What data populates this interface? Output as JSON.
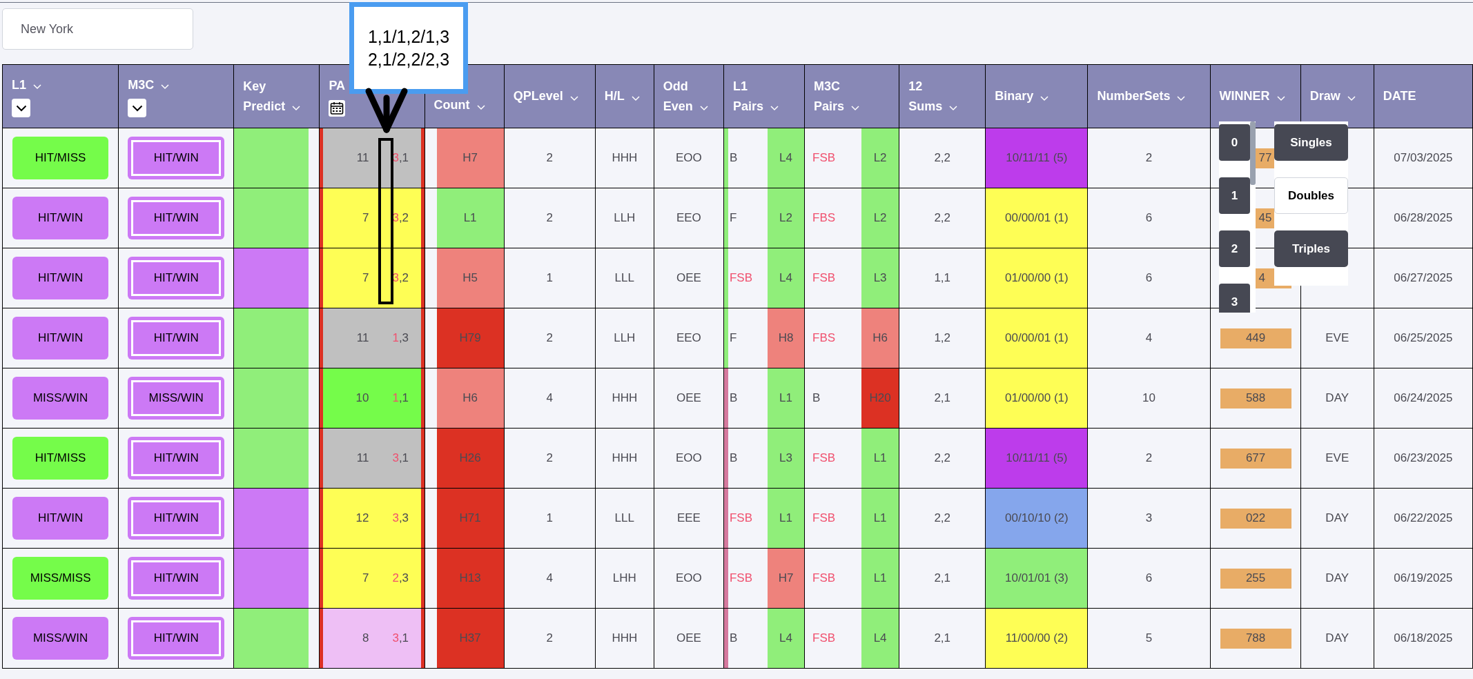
{
  "search": {
    "value": "New York"
  },
  "columns": [
    {
      "label": [
        "L1"
      ],
      "chevron": true,
      "kind": "dropdown"
    },
    {
      "label": [
        "M3C"
      ],
      "chevron": true,
      "kind": "dropdown"
    },
    {
      "label": [
        "Key",
        "Predict"
      ],
      "chevron": true
    },
    {
      "label": [
        "PA"
      ],
      "chevron": false,
      "kind": "calendar"
    },
    {
      "label": [
        "Count"
      ],
      "chevron": true
    },
    {
      "label": [
        "QPLevel"
      ],
      "chevron": true
    },
    {
      "label": [
        "H/L"
      ],
      "chevron": true
    },
    {
      "label": [
        "Odd",
        "Even"
      ],
      "chevron": true
    },
    {
      "label": [
        "L1",
        "Pairs"
      ],
      "chevron": true
    },
    {
      "label": [
        "M3C",
        "Pairs"
      ],
      "chevron": true
    },
    {
      "label": [
        "12",
        "Sums"
      ],
      "chevron": true
    },
    {
      "label": [
        "Binary"
      ],
      "chevron": true
    },
    {
      "label": [
        "NumberSets"
      ],
      "chevron": true
    },
    {
      "label": [
        "WINNER"
      ],
      "chevron": true
    },
    {
      "label": [
        "Draw"
      ],
      "chevron": true
    },
    {
      "label": [
        "DATE"
      ],
      "chevron": false
    }
  ],
  "rows": [
    {
      "l1": {
        "text": "HIT/MISS",
        "color": "#75fc4a"
      },
      "m3c": "HIT/WIN",
      "key": {
        "color": "#90ee7a"
      },
      "pair": {
        "color": "#c0c0c0",
        "sum": "11",
        "first": "3",
        "rest": ",1"
      },
      "count": {
        "text": "H7",
        "color": "#ee827c"
      },
      "qp": "2",
      "hl": "HHH",
      "oe": "EOO",
      "marker": {
        "color": "#90ee7a"
      },
      "l1_pairs": {
        "tag": {
          "text": "B",
          "color": "#4a4a52"
        },
        "code": {
          "text": "L4",
          "color": "#90ee7a"
        }
      },
      "m3c_pairs": {
        "tag": {
          "text": "FSB",
          "color": "#f0506e"
        },
        "code": {
          "text": "L2",
          "color": "#90ee7a"
        }
      },
      "sums": "2,2",
      "binary": {
        "text": "10/11/11 (5)",
        "color": "#bd3ceb"
      },
      "number_sets": "2",
      "winner": {
        "text": "77",
        "covered": true
      },
      "date": "07/03/2025"
    },
    {
      "l1": {
        "text": "HIT/WIN",
        "color": "#cc79f5"
      },
      "m3c": "HIT/WIN",
      "key": {
        "color": "#90ee7a"
      },
      "pair": {
        "color": "#fefe55",
        "sum": "7",
        "first": "3",
        "rest": ",2"
      },
      "count": {
        "text": "L1",
        "color": "#90ee7a"
      },
      "qp": "2",
      "hl": "LLH",
      "oe": "EEO",
      "marker": {
        "color": "#90ee7a"
      },
      "l1_pairs": {
        "tag": {
          "text": "F",
          "color": "#4a4a52"
        },
        "code": {
          "text": "L2",
          "color": "#90ee7a"
        }
      },
      "m3c_pairs": {
        "tag": {
          "text": "FBS",
          "color": "#f0506e"
        },
        "code": {
          "text": "L2",
          "color": "#90ee7a"
        }
      },
      "sums": "2,2",
      "binary": {
        "text": "00/00/01 (1)",
        "color": "#fefe55"
      },
      "number_sets": "6",
      "winner": {
        "text": "45",
        "covered": true
      },
      "date": "06/28/2025"
    },
    {
      "l1": {
        "text": "HIT/WIN",
        "color": "#cc79f5"
      },
      "m3c": "HIT/WIN",
      "key": {
        "color": "#cc79f5"
      },
      "pair": {
        "color": "#fefe55",
        "sum": "7",
        "first": "3",
        "rest": ",2"
      },
      "count": {
        "text": "H5",
        "color": "#ee827c"
      },
      "qp": "1",
      "hl": "LLL",
      "oe": "OEE",
      "marker": {
        "color": "#90ee7a"
      },
      "l1_pairs": {
        "tag": {
          "text": "FSB",
          "color": "#f0506e"
        },
        "code": {
          "text": "L4",
          "color": "#90ee7a"
        }
      },
      "m3c_pairs": {
        "tag": {
          "text": "FSB",
          "color": "#f0506e"
        },
        "code": {
          "text": "L3",
          "color": "#90ee7a"
        }
      },
      "sums": "1,1",
      "binary": {
        "text": "01/00/00 (1)",
        "color": "#fefe55"
      },
      "number_sets": "6",
      "winner": {
        "text": "4",
        "covered": true
      },
      "date": "06/27/2025"
    },
    {
      "l1": {
        "text": "HIT/WIN",
        "color": "#cc79f5"
      },
      "m3c": "HIT/WIN",
      "key": {
        "color": "#90ee7a"
      },
      "pair": {
        "color": "#c0c0c0",
        "sum": "11",
        "first": "1",
        "rest": ",3"
      },
      "count": {
        "text": "H79",
        "color": "#dc3123"
      },
      "qp": "2",
      "hl": "LLH",
      "oe": "EEO",
      "marker": {
        "color": "#90ee7a"
      },
      "l1_pairs": {
        "tag": {
          "text": "F",
          "color": "#4a4a52"
        },
        "code": {
          "text": "H8",
          "color": "#ee827c"
        }
      },
      "m3c_pairs": {
        "tag": {
          "text": "FBS",
          "color": "#f0506e"
        },
        "code": {
          "text": "H6",
          "color": "#ee827c"
        }
      },
      "sums": "1,2",
      "binary": {
        "text": "00/00/01 (1)",
        "color": "#fefe55"
      },
      "number_sets": "4",
      "winner": {
        "text": "449",
        "covered": false
      },
      "draw": "EVE",
      "date": "06/25/2025"
    },
    {
      "l1": {
        "text": "MISS/WIN",
        "color": "#cc79f5"
      },
      "m3c": "MISS/WIN",
      "key": {
        "color": "#90ee7a"
      },
      "pair": {
        "color": "#75fc4a",
        "sum": "10",
        "first": "1",
        "rest": ",1"
      },
      "count": {
        "text": "H6",
        "color": "#ee827c"
      },
      "qp": "4",
      "hl": "HHH",
      "oe": "OEE",
      "marker": {
        "color": "#d57a9e"
      },
      "l1_pairs": {
        "tag": {
          "text": "B",
          "color": "#4a4a52"
        },
        "code": {
          "text": "L1",
          "color": "#90ee7a"
        }
      },
      "m3c_pairs": {
        "tag": {
          "text": "B",
          "color": "#4a4a52"
        },
        "code": {
          "text": "H20",
          "color": "#dc3123"
        }
      },
      "sums": "2,1",
      "binary": {
        "text": "01/00/00 (1)",
        "color": "#fefe55"
      },
      "number_sets": "10",
      "winner": {
        "text": "588",
        "covered": false
      },
      "draw": "DAY",
      "date": "06/24/2025"
    },
    {
      "l1": {
        "text": "HIT/MISS",
        "color": "#75fc4a"
      },
      "m3c": "HIT/WIN",
      "key": {
        "color": "#90ee7a"
      },
      "pair": {
        "color": "#c0c0c0",
        "sum": "11",
        "first": "3",
        "rest": ",1"
      },
      "count": {
        "text": "H26",
        "color": "#dc3123"
      },
      "qp": "2",
      "hl": "HHH",
      "oe": "EOO",
      "marker": {
        "color": "#d57a9e"
      },
      "l1_pairs": {
        "tag": {
          "text": "B",
          "color": "#4a4a52"
        },
        "code": {
          "text": "L3",
          "color": "#90ee7a"
        }
      },
      "m3c_pairs": {
        "tag": {
          "text": "FSB",
          "color": "#f0506e"
        },
        "code": {
          "text": "L1",
          "color": "#90ee7a"
        }
      },
      "sums": "2,2",
      "binary": {
        "text": "10/11/11 (5)",
        "color": "#bd3ceb"
      },
      "number_sets": "2",
      "winner": {
        "text": "677",
        "covered": false
      },
      "draw": "EVE",
      "date": "06/23/2025"
    },
    {
      "l1": {
        "text": "HIT/WIN",
        "color": "#cc79f5"
      },
      "m3c": "HIT/WIN",
      "key": {
        "color": "#cc79f5"
      },
      "pair": {
        "color": "#fefe55",
        "sum": "12",
        "first": "3",
        "rest": ",3"
      },
      "count": {
        "text": "H71",
        "color": "#dc3123"
      },
      "qp": "1",
      "hl": "LLL",
      "oe": "EEE",
      "marker": {
        "color": "#d57a9e"
      },
      "l1_pairs": {
        "tag": {
          "text": "FSB",
          "color": "#f0506e"
        },
        "code": {
          "text": "L1",
          "color": "#90ee7a"
        }
      },
      "m3c_pairs": {
        "tag": {
          "text": "FSB",
          "color": "#f0506e"
        },
        "code": {
          "text": "L1",
          "color": "#90ee7a"
        }
      },
      "sums": "2,2",
      "binary": {
        "text": "00/10/10 (2)",
        "color": "#85a6ec"
      },
      "number_sets": "3",
      "winner": {
        "text": "022",
        "covered": false
      },
      "draw": "DAY",
      "date": "06/22/2025"
    },
    {
      "l1": {
        "text": "MISS/MISS",
        "color": "#75fc4a"
      },
      "m3c": "HIT/WIN",
      "key": {
        "color": "#cc79f5"
      },
      "pair": {
        "color": "#fefe55",
        "sum": "7",
        "first": "2",
        "rest": ",3"
      },
      "count": {
        "text": "H13",
        "color": "#dc3123"
      },
      "qp": "4",
      "hl": "LHH",
      "oe": "EOO",
      "marker": {
        "color": "#d57a9e"
      },
      "l1_pairs": {
        "tag": {
          "text": "FSB",
          "color": "#f0506e"
        },
        "code": {
          "text": "H7",
          "color": "#ee827c"
        }
      },
      "m3c_pairs": {
        "tag": {
          "text": "FSB",
          "color": "#f0506e"
        },
        "code": {
          "text": "L1",
          "color": "#90ee7a"
        }
      },
      "sums": "2,1",
      "binary": {
        "text": "10/01/01 (3)",
        "color": "#90ee7a"
      },
      "number_sets": "6",
      "winner": {
        "text": "255",
        "covered": false
      },
      "draw": "DAY",
      "date": "06/19/2025"
    },
    {
      "l1": {
        "text": "MISS/WIN",
        "color": "#cc79f5"
      },
      "m3c": "HIT/WIN",
      "key": {
        "color": "#90ee7a"
      },
      "pair": {
        "color": "#eebff5",
        "sum": "8",
        "first": "3",
        "rest": ",1"
      },
      "count": {
        "text": "H37",
        "color": "#dc3123"
      },
      "qp": "2",
      "hl": "HHH",
      "oe": "OEE",
      "marker": {
        "color": "#d57a9e"
      },
      "l1_pairs": {
        "tag": {
          "text": "B",
          "color": "#4a4a52"
        },
        "code": {
          "text": "L4",
          "color": "#90ee7a"
        }
      },
      "m3c_pairs": {
        "tag": {
          "text": "FSB",
          "color": "#f0506e"
        },
        "code": {
          "text": "L4",
          "color": "#90ee7a"
        }
      },
      "sums": "2,1",
      "binary": {
        "text": "11/00/00 (2)",
        "color": "#fefe55"
      },
      "number_sets": "5",
      "winner": {
        "text": "788",
        "covered": false
      },
      "draw": "DAY",
      "date": "06/18/2025"
    }
  ],
  "number_picker": [
    "0",
    "1",
    "2",
    "3"
  ],
  "set_options": [
    {
      "label": "Singles",
      "selected": false
    },
    {
      "label": "Doubles",
      "selected": true
    },
    {
      "label": "Triples",
      "selected": false
    }
  ],
  "tooltip": {
    "lines": [
      "1,1/1,2/1,3",
      "2,1/2,2/2,3"
    ]
  }
}
